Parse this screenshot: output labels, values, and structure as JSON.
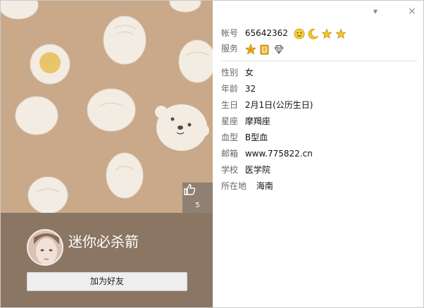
{
  "window": {
    "dropdown_glyph": "▾",
    "close_glyph": "×"
  },
  "cover": {
    "like_count": "5",
    "like_icon": "thumbs-up-icon"
  },
  "profile": {
    "nickname": "迷你必杀箭",
    "add_friend_label": "加为好友"
  },
  "account": {
    "label": "帐号",
    "value": "65642362",
    "level_icons": [
      "smiley-icon",
      "moon-icon",
      "star-icon",
      "star-icon"
    ]
  },
  "service": {
    "label": "服务",
    "icons": [
      "vip-star-icon",
      "qq-book-icon",
      "diamond-icon"
    ]
  },
  "details": [
    {
      "key": "gender",
      "label": "性别",
      "value": "女"
    },
    {
      "key": "age",
      "label": "年龄",
      "value": "32"
    },
    {
      "key": "birthday",
      "label": "生日",
      "value": "2月1日(公历生日)"
    },
    {
      "key": "constellation",
      "label": "星座",
      "value": "摩羯座"
    },
    {
      "key": "blood",
      "label": "血型",
      "value": "B型血"
    },
    {
      "key": "email",
      "label": "邮箱",
      "value": "www.775822.cn"
    },
    {
      "key": "school",
      "label": "学校",
      "value": "医学院"
    },
    {
      "key": "location",
      "label": "所在地",
      "value": "海南"
    }
  ],
  "colors": {
    "cover_bg": "#c9a98a",
    "profile_bar": "#8b7663",
    "dumpling": "#f3ece3",
    "yolk": "#e8c56a"
  }
}
